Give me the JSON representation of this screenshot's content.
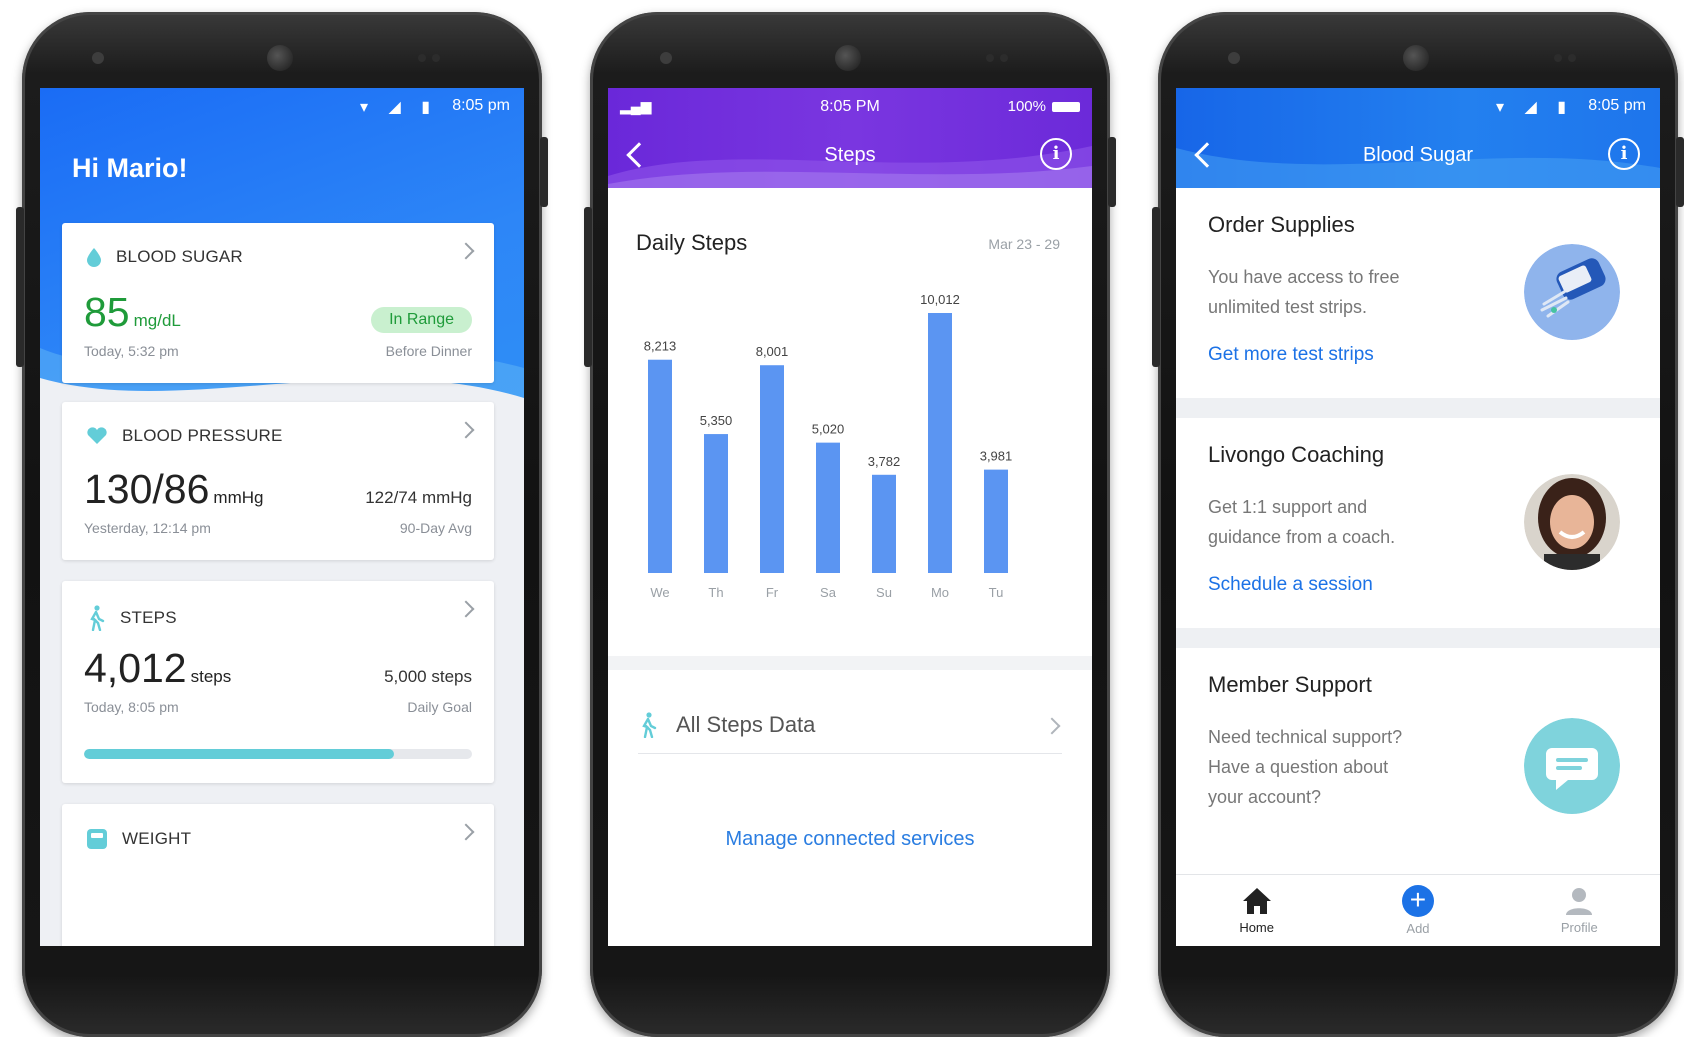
{
  "phone1": {
    "status_time": "8:05 pm",
    "greeting": "Hi Mario!",
    "blood_sugar": {
      "title": "BLOOD SUGAR",
      "value": "85",
      "unit": "mg/dL",
      "time": "Today, 5:32 pm",
      "badge": "In Range",
      "context": "Before Dinner"
    },
    "blood_pressure": {
      "title": "BLOOD PRESSURE",
      "value": "130/86",
      "unit": "mmHg",
      "time": "Yesterday, 12:14 pm",
      "avg_value": "122/74 mmHg",
      "avg_label": "90-Day Avg"
    },
    "steps": {
      "title": "STEPS",
      "value": "4,012",
      "unit": "steps",
      "time": "Today, 8:05 pm",
      "goal_value": "5,000 steps",
      "goal_label": "Daily Goal",
      "progress_fraction": 0.8
    },
    "weight": {
      "title": "WEIGHT"
    }
  },
  "phone2": {
    "status_time": "8:05 PM",
    "battery": "100%",
    "title": "Steps",
    "chart_data": {
      "type": "bar",
      "title": "Daily Steps",
      "subtitle": "Mar 23 - 29",
      "categories": [
        "We",
        "Th",
        "Fr",
        "Sa",
        "Su",
        "Mo",
        "Tu"
      ],
      "values": [
        8213,
        5350,
        8001,
        5020,
        3782,
        10012,
        3981
      ],
      "value_labels": [
        "8,213",
        "5,350",
        "8,001",
        "5,020",
        "3,782",
        "10,012",
        "3,981"
      ],
      "ylim": [
        0,
        10012
      ],
      "grid": false,
      "color": "#5b95f2"
    },
    "all_steps_label": "All Steps Data",
    "manage_label": "Manage connected services"
  },
  "phone3": {
    "status_time": "8:05 pm",
    "title": "Blood Sugar",
    "order": {
      "heading": "Order Supplies",
      "body": "You have access to free\nunlimited test strips.",
      "link": "Get more test strips"
    },
    "coaching": {
      "heading": "Livongo Coaching",
      "body": "Get 1:1 support and\nguidance from a coach.",
      "link": "Schedule a session"
    },
    "support": {
      "heading": "Member Support",
      "body": "Need technical support?\nHave a question about\nyour account?"
    },
    "tabs": {
      "home": "Home",
      "add": "Add",
      "profile": "Profile"
    }
  },
  "colors": {
    "brand_blue": "#1a6cf5",
    "purple": "#6a28d9",
    "in_range_green": "#1f9b3a",
    "progress_teal": "#63cdd8",
    "link_blue": "#1c72e6"
  }
}
